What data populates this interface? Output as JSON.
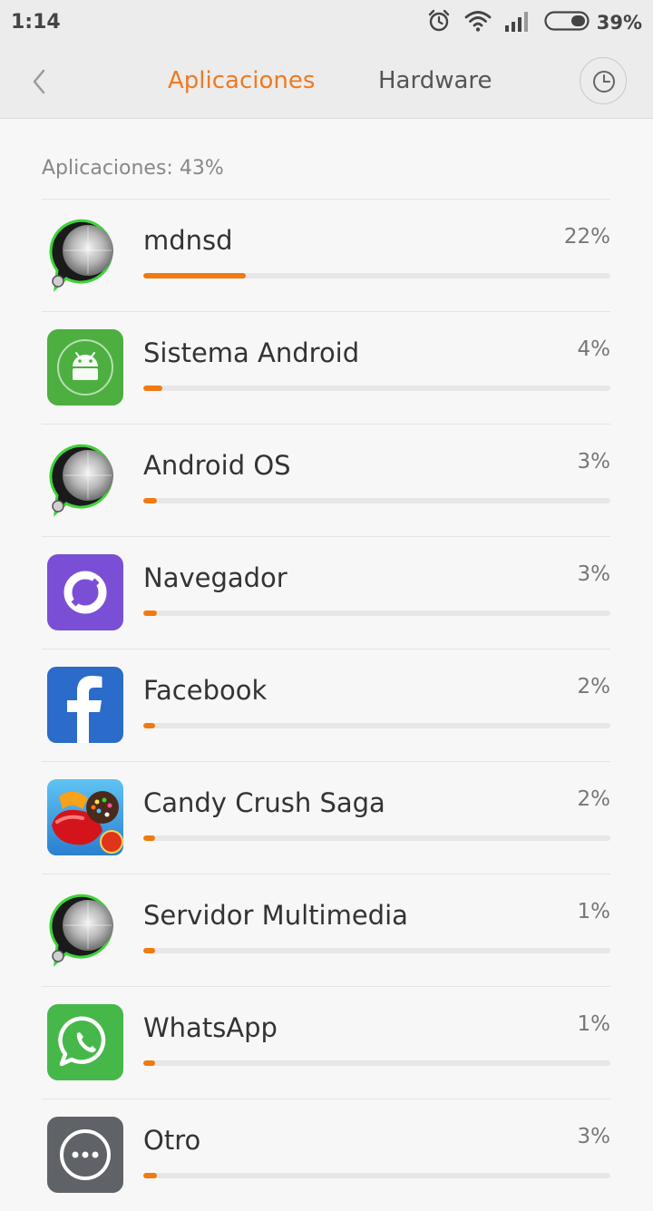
{
  "status_bar": {
    "time": "1:14",
    "battery_percent": "39%",
    "icons": [
      "alarm-icon",
      "wifi-icon",
      "signal-icon",
      "battery-icon"
    ]
  },
  "header": {
    "tabs": [
      {
        "label": "Aplicaciones",
        "active": true
      },
      {
        "label": "Hardware",
        "active": false
      }
    ],
    "back_icon": "chevron-left-icon",
    "history_icon": "clock-icon"
  },
  "section": {
    "title": "Aplicaciones: 43%"
  },
  "apps": [
    {
      "name": "mdnsd",
      "percent_label": "22%",
      "usage": 0.22,
      "icon": "system-process-icon"
    },
    {
      "name": "Sistema Android",
      "percent_label": "4%",
      "usage": 0.04,
      "icon": "android-icon"
    },
    {
      "name": "Android OS",
      "percent_label": "3%",
      "usage": 0.03,
      "icon": "system-process-icon"
    },
    {
      "name": "Navegador",
      "percent_label": "3%",
      "usage": 0.03,
      "icon": "browser-icon"
    },
    {
      "name": "Facebook",
      "percent_label": "2%",
      "usage": 0.02,
      "icon": "facebook-icon"
    },
    {
      "name": "Candy Crush Saga",
      "percent_label": "2%",
      "usage": 0.02,
      "icon": "candy-crush-icon"
    },
    {
      "name": "Servidor Multimedia",
      "percent_label": "1%",
      "usage": 0.01,
      "icon": "system-process-icon"
    },
    {
      "name": "WhatsApp",
      "percent_label": "1%",
      "usage": 0.01,
      "icon": "whatsapp-icon"
    },
    {
      "name": "Otro",
      "percent_label": "3%",
      "usage": 0.03,
      "icon": "more-icon"
    }
  ],
  "colors": {
    "accent": "#f07a10",
    "active_tab": "#f07a22"
  }
}
